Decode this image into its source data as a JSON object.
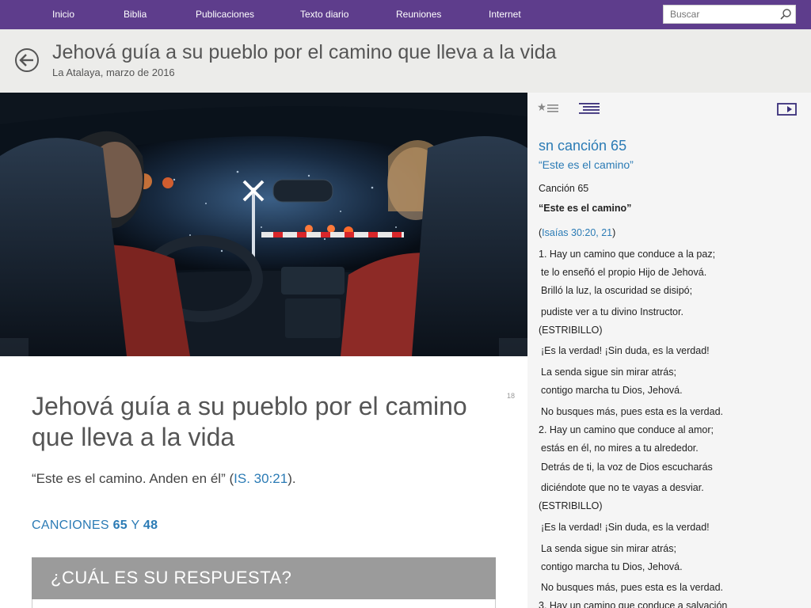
{
  "nav": {
    "items": [
      "Inicio",
      "Biblia",
      "Publicaciones",
      "Texto diario",
      "Reuniones",
      "Internet"
    ],
    "search_placeholder": "Buscar"
  },
  "header": {
    "title": "Jehová guía a su pueblo por el camino que lleva a la vida",
    "subtitle": "La Atalaya, marzo de 2016"
  },
  "article": {
    "page_number": "18",
    "title": "Jehová guía a su pueblo por el camino que lleva a la vida",
    "theme_text": "“Este es el camino. Anden en él” (",
    "theme_ref": "IS. 30:21",
    "theme_end": ").",
    "songs_prefix": "CANCIONES ",
    "song1": "65",
    "songs_and": " Y ",
    "song2": "48",
    "question_heading": "¿CUÁL ES SU RESPUESTA?"
  },
  "side": {
    "title": "sn canción 65",
    "subtitle": "“Este es el camino”",
    "song_label": "Canción 65",
    "song_title": "“Este es el camino”",
    "ref_open": "(",
    "ref": "Isaías 30:20, 21",
    "ref_close": ")",
    "lines": [
      "1. Hay un camino que conduce a la paz;",
      "te lo enseñó el propio Hijo de Jehová.",
      "Brilló la luz, la oscuridad se disipó;",
      "pudiste ver a tu divino Instructor.",
      "(ESTRIBILLO)",
      "¡Es la verdad! ¡Sin duda, es la verdad!",
      "La senda sigue sin mirar atrás;",
      "contigo marcha tu Dios, Jehová.",
      "No busques más, pues esta es la verdad.",
      "2. Hay un camino que conduce al amor;",
      "estás en él, no mires a tu alrededor.",
      "Detrás de ti, la voz de Dios escucharás",
      "diciéndote que no te vayas a desviar.",
      "(ESTRIBILLO)",
      "¡Es la verdad! ¡Sin duda, es la verdad!",
      "La senda sigue sin mirar atrás;",
      "contigo marcha tu Dios, Jehová.",
      "No busques más, pues esta es la verdad.",
      "3. Hay un camino que conduce a salvación"
    ]
  },
  "colors": {
    "nav_bg": "#5e3d8c",
    "link": "#2b7bb5",
    "header_bg": "#ececea",
    "question_bg": "#9b9b9b"
  }
}
